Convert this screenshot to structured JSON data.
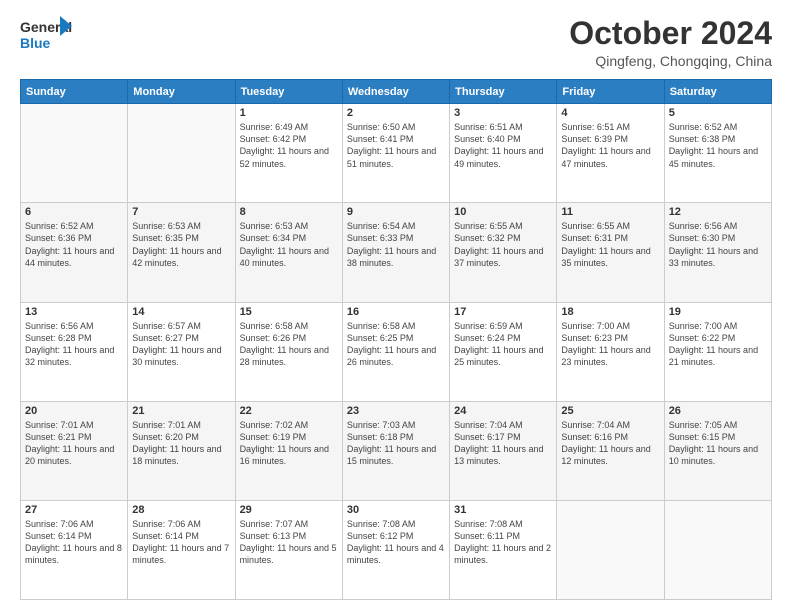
{
  "header": {
    "logo_line1": "General",
    "logo_line2": "Blue",
    "month": "October 2024",
    "location": "Qingfeng, Chongqing, China"
  },
  "weekdays": [
    "Sunday",
    "Monday",
    "Tuesday",
    "Wednesday",
    "Thursday",
    "Friday",
    "Saturday"
  ],
  "weeks": [
    [
      {
        "day": "",
        "info": ""
      },
      {
        "day": "",
        "info": ""
      },
      {
        "day": "1",
        "info": "Sunrise: 6:49 AM\nSunset: 6:42 PM\nDaylight: 11 hours and 52 minutes."
      },
      {
        "day": "2",
        "info": "Sunrise: 6:50 AM\nSunset: 6:41 PM\nDaylight: 11 hours and 51 minutes."
      },
      {
        "day": "3",
        "info": "Sunrise: 6:51 AM\nSunset: 6:40 PM\nDaylight: 11 hours and 49 minutes."
      },
      {
        "day": "4",
        "info": "Sunrise: 6:51 AM\nSunset: 6:39 PM\nDaylight: 11 hours and 47 minutes."
      },
      {
        "day": "5",
        "info": "Sunrise: 6:52 AM\nSunset: 6:38 PM\nDaylight: 11 hours and 45 minutes."
      }
    ],
    [
      {
        "day": "6",
        "info": "Sunrise: 6:52 AM\nSunset: 6:36 PM\nDaylight: 11 hours and 44 minutes."
      },
      {
        "day": "7",
        "info": "Sunrise: 6:53 AM\nSunset: 6:35 PM\nDaylight: 11 hours and 42 minutes."
      },
      {
        "day": "8",
        "info": "Sunrise: 6:53 AM\nSunset: 6:34 PM\nDaylight: 11 hours and 40 minutes."
      },
      {
        "day": "9",
        "info": "Sunrise: 6:54 AM\nSunset: 6:33 PM\nDaylight: 11 hours and 38 minutes."
      },
      {
        "day": "10",
        "info": "Sunrise: 6:55 AM\nSunset: 6:32 PM\nDaylight: 11 hours and 37 minutes."
      },
      {
        "day": "11",
        "info": "Sunrise: 6:55 AM\nSunset: 6:31 PM\nDaylight: 11 hours and 35 minutes."
      },
      {
        "day": "12",
        "info": "Sunrise: 6:56 AM\nSunset: 6:30 PM\nDaylight: 11 hours and 33 minutes."
      }
    ],
    [
      {
        "day": "13",
        "info": "Sunrise: 6:56 AM\nSunset: 6:28 PM\nDaylight: 11 hours and 32 minutes."
      },
      {
        "day": "14",
        "info": "Sunrise: 6:57 AM\nSunset: 6:27 PM\nDaylight: 11 hours and 30 minutes."
      },
      {
        "day": "15",
        "info": "Sunrise: 6:58 AM\nSunset: 6:26 PM\nDaylight: 11 hours and 28 minutes."
      },
      {
        "day": "16",
        "info": "Sunrise: 6:58 AM\nSunset: 6:25 PM\nDaylight: 11 hours and 26 minutes."
      },
      {
        "day": "17",
        "info": "Sunrise: 6:59 AM\nSunset: 6:24 PM\nDaylight: 11 hours and 25 minutes."
      },
      {
        "day": "18",
        "info": "Sunrise: 7:00 AM\nSunset: 6:23 PM\nDaylight: 11 hours and 23 minutes."
      },
      {
        "day": "19",
        "info": "Sunrise: 7:00 AM\nSunset: 6:22 PM\nDaylight: 11 hours and 21 minutes."
      }
    ],
    [
      {
        "day": "20",
        "info": "Sunrise: 7:01 AM\nSunset: 6:21 PM\nDaylight: 11 hours and 20 minutes."
      },
      {
        "day": "21",
        "info": "Sunrise: 7:01 AM\nSunset: 6:20 PM\nDaylight: 11 hours and 18 minutes."
      },
      {
        "day": "22",
        "info": "Sunrise: 7:02 AM\nSunset: 6:19 PM\nDaylight: 11 hours and 16 minutes."
      },
      {
        "day": "23",
        "info": "Sunrise: 7:03 AM\nSunset: 6:18 PM\nDaylight: 11 hours and 15 minutes."
      },
      {
        "day": "24",
        "info": "Sunrise: 7:04 AM\nSunset: 6:17 PM\nDaylight: 11 hours and 13 minutes."
      },
      {
        "day": "25",
        "info": "Sunrise: 7:04 AM\nSunset: 6:16 PM\nDaylight: 11 hours and 12 minutes."
      },
      {
        "day": "26",
        "info": "Sunrise: 7:05 AM\nSunset: 6:15 PM\nDaylight: 11 hours and 10 minutes."
      }
    ],
    [
      {
        "day": "27",
        "info": "Sunrise: 7:06 AM\nSunset: 6:14 PM\nDaylight: 11 hours and 8 minutes."
      },
      {
        "day": "28",
        "info": "Sunrise: 7:06 AM\nSunset: 6:14 PM\nDaylight: 11 hours and 7 minutes."
      },
      {
        "day": "29",
        "info": "Sunrise: 7:07 AM\nSunset: 6:13 PM\nDaylight: 11 hours and 5 minutes."
      },
      {
        "day": "30",
        "info": "Sunrise: 7:08 AM\nSunset: 6:12 PM\nDaylight: 11 hours and 4 minutes."
      },
      {
        "day": "31",
        "info": "Sunrise: 7:08 AM\nSunset: 6:11 PM\nDaylight: 11 hours and 2 minutes."
      },
      {
        "day": "",
        "info": ""
      },
      {
        "day": "",
        "info": ""
      }
    ]
  ]
}
